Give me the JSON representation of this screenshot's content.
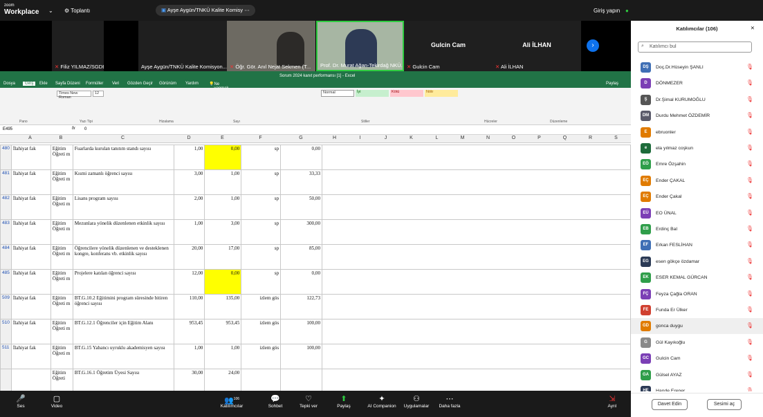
{
  "topbar": {
    "logo_top": "zoom",
    "logo_main": "Workplace",
    "meeting_tab": "Toplantı",
    "pill": "Ayşe Aygün/TNKÜ Kalite Komisy",
    "signin": "Giriş yapın",
    "record": "Kayıt",
    "view": "Görüntüle"
  },
  "tiles": [
    {
      "name": "Filiz YILMAZ/SGDB"
    },
    {
      "name": "Ayşe Aygün/TNKÜ Kalite Komisyon..."
    },
    {
      "name": "Öğr. Gör. Anıl Nejat Sekmen (T..."
    },
    {
      "name": "Prof. Dr. Murat Ağan-Tekirdağ NKÜ..."
    },
    {
      "name": "Gulcin Cam",
      "big": "Gulcin Cam"
    },
    {
      "name": "Ali İLHAN",
      "big": "Ali İLHAN"
    }
  ],
  "excel": {
    "title": "Sorum 2024 kanıt performansı [1] - Excel",
    "tabs": [
      "Dosya",
      "Giriş",
      "Ekle",
      "Sayfa Düzeni",
      "Formüller",
      "Veri",
      "Gözden Geçir",
      "Görünüm",
      "Yardım",
      "Ne yapmak istediğinizi söyleyin"
    ],
    "share": "Paylaş",
    "groups": [
      "Pano",
      "Yazı Tipi",
      "Hizalama",
      "Sayı",
      "Stiller",
      "Hücreler",
      "Düzenleme"
    ],
    "font": "Times New Roman",
    "size": "12",
    "style_normal": "Normal",
    "style_good": "İyi",
    "style_bad": "Kötü",
    "style_neutral": "Nötr",
    "namebox": "E495",
    "formula": "0",
    "columns": [
      "A",
      "B",
      "C",
      "D",
      "E",
      "F",
      "G",
      "H",
      "I",
      "J",
      "K",
      "L",
      "M",
      "N",
      "O",
      "P",
      "Q",
      "R",
      "S"
    ]
  },
  "rows": [
    {
      "n": "480",
      "a": "İlahiyat fak",
      "b": "Eğitim Öğreti m",
      "c": "Fuarlarda kurulan tanıtım standı sayısı",
      "d": "1,00",
      "e": "0,00",
      "f": "sp",
      "g": "0,00",
      "yel": true
    },
    {
      "n": "481",
      "a": "İlahiyat fak",
      "b": "Eğitim Öğreti m",
      "c": "Kısmi zamanlı öğrenci sayısı",
      "d": "3,00",
      "e": "1,00",
      "f": "sp",
      "g": "33,33",
      "yel": false
    },
    {
      "n": "482",
      "a": "İlahiyat fak",
      "b": "Eğitim Öğreti m",
      "c": "Lisans program sayısı",
      "d": "2,00",
      "e": "1,00",
      "f": "sp",
      "g": "50,00",
      "yel": false
    },
    {
      "n": "483",
      "a": "İlahiyat fak",
      "b": "Eğitim Öğreti m",
      "c": "Mezunlara yönelik düzenlenen etkinlik sayısı",
      "d": "1,00",
      "e": "3,00",
      "f": "sp",
      "g": "300,00",
      "yel": false
    },
    {
      "n": "484",
      "a": "İlahiyat fak",
      "b": "Eğitim Öğreti m",
      "c": "Öğrencilere yönelik düzenlenen ve desteklenen kongre, konferans vb. etkinlik sayısı",
      "d": "20,00",
      "e": "17,00",
      "f": "sp",
      "g": "85,00",
      "yel": false
    },
    {
      "n": "485",
      "a": "İlahiyat fak",
      "b": "Eğitim Öğreti m",
      "c": "Projelere katılan öğrenci sayısı",
      "d": "12,00",
      "e": "0,00",
      "f": "sp",
      "g": "0,00",
      "yel": true
    },
    {
      "n": "509",
      "a": "İlahiyat fak",
      "b": "Eğitim Öğreti m",
      "c": "BT.G.10.2 Eğitimini program süresinde bitiren öğrenci sayısı",
      "d": "110,00",
      "e": "135,00",
      "f": "izlem gös",
      "g": "122,73",
      "yel": false
    },
    {
      "n": "510",
      "a": "İlahiyat fak",
      "b": "Eğitim Öğreti m",
      "c": "BT.G.12.1 Öğrenciler için Eğitim Alanı",
      "d": "953,45",
      "e": "953,45",
      "f": "izlem gös",
      "g": "100,00",
      "yel": false
    },
    {
      "n": "511",
      "a": "İlahiyat fak",
      "b": "Eğitim Öğreti m",
      "c": "BT.G.15 Yabancı uyruklu akademisyen sayısı",
      "d": "1,00",
      "e": "1,00",
      "f": "izlem gös",
      "g": "100,00",
      "yel": false
    },
    {
      "n": "",
      "a": "",
      "b": "Eğitim Öğreti",
      "c": "BT.G.16.1 Öğretim Üyesi Sayısı",
      "d": "30,00",
      "e": "24,00",
      "f": "",
      "g": "",
      "yel": false
    }
  ],
  "bottombar": [
    "Ses",
    "Video",
    "Katılımcılar",
    "Sohbet",
    "Tepki ver",
    "Paylaş",
    "AI Companion",
    "Uygulamalar",
    "Daha fazla",
    "Ayrıl"
  ],
  "participants_count": "106",
  "panel": {
    "title": "Katılımcılar (106)",
    "search": "Katılımcı bul",
    "invite": "Davet Edin",
    "unmute": "Sesimi aç"
  },
  "participants": [
    {
      "ini": "DŞ",
      "name": "Doç.Dr.Hüseyin ŞANLI",
      "color": "#3f6fb5"
    },
    {
      "ini": "D",
      "name": "DÖNMEZER",
      "color": "#7b3fb5"
    },
    {
      "ini": "Ş",
      "name": "Dr.Şimal KURUMOĞLU",
      "color": "#555555"
    },
    {
      "ini": "DM",
      "name": "Durdu Mehmet ÖZDEMİR",
      "color": "#5a5a6a"
    },
    {
      "ini": "E",
      "name": "ebruonler",
      "color": "#e07b00"
    },
    {
      "ini": "e",
      "name": "ela yılmaz coşkun",
      "color": "#1d6b3a"
    },
    {
      "ini": "EÖ",
      "name": "Emre Özşahin",
      "color": "#2f9e4a"
    },
    {
      "ini": "EÇ",
      "name": "Ender ÇAKAL",
      "color": "#e07b00"
    },
    {
      "ini": "EÇ",
      "name": "Ender Çakal",
      "color": "#e07b00"
    },
    {
      "ini": "EÜ",
      "name": "EO ÜNAL",
      "color": "#7b3fb5"
    },
    {
      "ini": "EB",
      "name": "Erdinç Bal",
      "color": "#2f9e4a"
    },
    {
      "ini": "EF",
      "name": "Erkan FESLİHAN",
      "color": "#3f6fb5"
    },
    {
      "ini": "EG",
      "name": "esen gökçe özdamar",
      "color": "#2b3a55"
    },
    {
      "ini": "EK",
      "name": "ESER KEMAL GÜRCAN",
      "color": "#2f9e4a"
    },
    {
      "ini": "FÇ",
      "name": "Feyza Çağla ORAN",
      "color": "#7b3fb5"
    },
    {
      "ini": "FE",
      "name": "Funda Er Ülker",
      "color": "#d04030"
    },
    {
      "ini": "GD",
      "name": "gonca duygu",
      "color": "#e07b00"
    },
    {
      "ini": "G",
      "name": "Gül Kayıkoğlu",
      "color": "#8a8a8a"
    },
    {
      "ini": "GC",
      "name": "Gulcin Cam",
      "color": "#7b3fb5"
    },
    {
      "ini": "GA",
      "name": "Gülsel AYAZ",
      "color": "#2f9e4a"
    },
    {
      "ini": "HE",
      "name": "Hande Erener",
      "color": "#2b3a55"
    }
  ]
}
